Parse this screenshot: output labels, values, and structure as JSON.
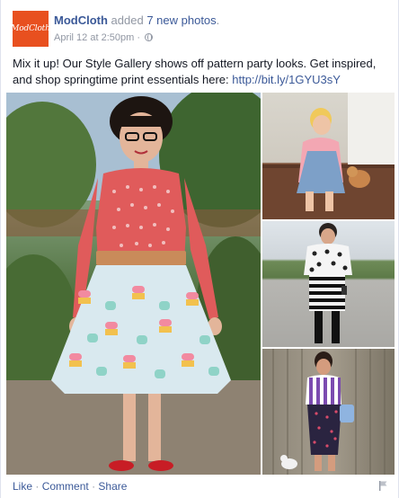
{
  "post": {
    "author": "ModCloth",
    "action_prefix": "added",
    "action_link": "7 new photos",
    "action_suffix": ".",
    "timestamp": "April 12 at 2:50pm",
    "separator": "·",
    "privacy_icon": "globe-icon",
    "logo_text": "ModCloth",
    "message_text": "Mix it up! Our Style Gallery shows off pattern party looks. Get inspired, and shop springtime print essentials here: ",
    "message_link": "http://bit.ly/1GYU3sY"
  },
  "photos": [
    {
      "label": "woman in red polka-dot top and cupcake skirt"
    },
    {
      "label": "woman in denim pinafore with dog"
    },
    {
      "label": "woman in polka-dot sweater and striped skirt"
    },
    {
      "label": "woman in striped top and patterned pencil skirt"
    }
  ],
  "actions": {
    "like": "Like",
    "comment": "Comment",
    "share": "Share",
    "dot": "·",
    "report_icon": "flag-icon"
  },
  "colors": {
    "link": "#3b5998",
    "meta": "#9197a3",
    "brand": "#e8501f"
  }
}
